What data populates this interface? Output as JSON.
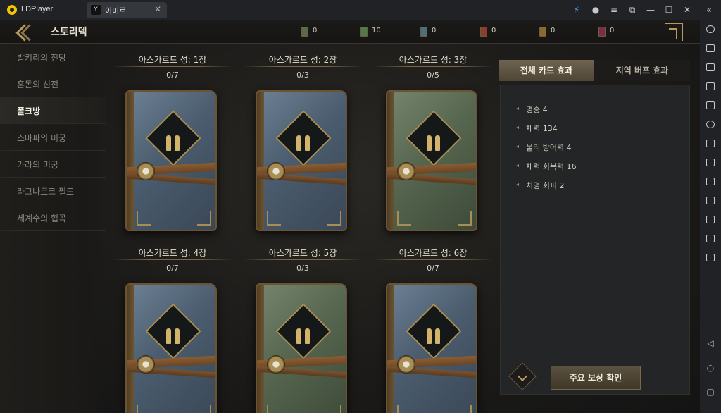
{
  "window": {
    "app_name": "LDPlayer",
    "tab_label": "이미르",
    "tab_icon_glyph": "Y",
    "tab_close": "✕",
    "controls": [
      "⚡",
      "●",
      "≡",
      "⧉",
      "—",
      "☐",
      "✕",
      "«"
    ]
  },
  "header": {
    "title": "스토리덱",
    "currencies": [
      {
        "value": "0",
        "color": "#5a6b49",
        "icon": "scroll-icon"
      },
      {
        "value": "10",
        "color": "#4f7a4a",
        "icon": "scroll-icon"
      },
      {
        "value": "0",
        "color": "#4c6f7a",
        "icon": "scroll-icon"
      },
      {
        "value": "0",
        "color": "#8a3f2e",
        "icon": "scroll-icon"
      },
      {
        "value": "0",
        "color": "#8a6a2e",
        "icon": "scroll-icon"
      },
      {
        "value": "0",
        "color": "#7a2e4a",
        "icon": "scroll-icon"
      }
    ]
  },
  "sidebar": {
    "items": [
      {
        "label": "발키리의 전당",
        "active": false
      },
      {
        "label": "혼돈의 신전",
        "active": false
      },
      {
        "label": "폴크방",
        "active": true
      },
      {
        "label": "스바파의 미궁",
        "active": false
      },
      {
        "label": "카라의 미궁",
        "active": false
      },
      {
        "label": "라그나로크 필드",
        "active": false
      },
      {
        "label": "세계수의 협곡",
        "active": false
      }
    ]
  },
  "cards": [
    {
      "title": "아스가르드 성: 1장",
      "count": "0/7",
      "theme": "blue"
    },
    {
      "title": "아스가르드 성: 2장",
      "count": "0/3",
      "theme": "blue"
    },
    {
      "title": "아스가르드 성: 3장",
      "count": "0/5",
      "theme": "green"
    },
    {
      "title": "아스가르드 성: 4장",
      "count": "0/7",
      "theme": "blue"
    },
    {
      "title": "아스가르드 성: 5장",
      "count": "0/3",
      "theme": "green"
    },
    {
      "title": "아스가르드 성: 6장",
      "count": "0/7",
      "theme": "blue"
    }
  ],
  "panel": {
    "tabs": [
      {
        "label": "전체 카드 효과",
        "active": true
      },
      {
        "label": "지역 버프 효과",
        "active": false
      }
    ],
    "effects": [
      "명중 4",
      "체력 134",
      "물리 방어력 4",
      "체력 회복력 16",
      "치명 회피 2"
    ],
    "reward_button": "주요 보상 확인"
  },
  "emulator_nav": [
    "◁",
    "○",
    "▢"
  ]
}
